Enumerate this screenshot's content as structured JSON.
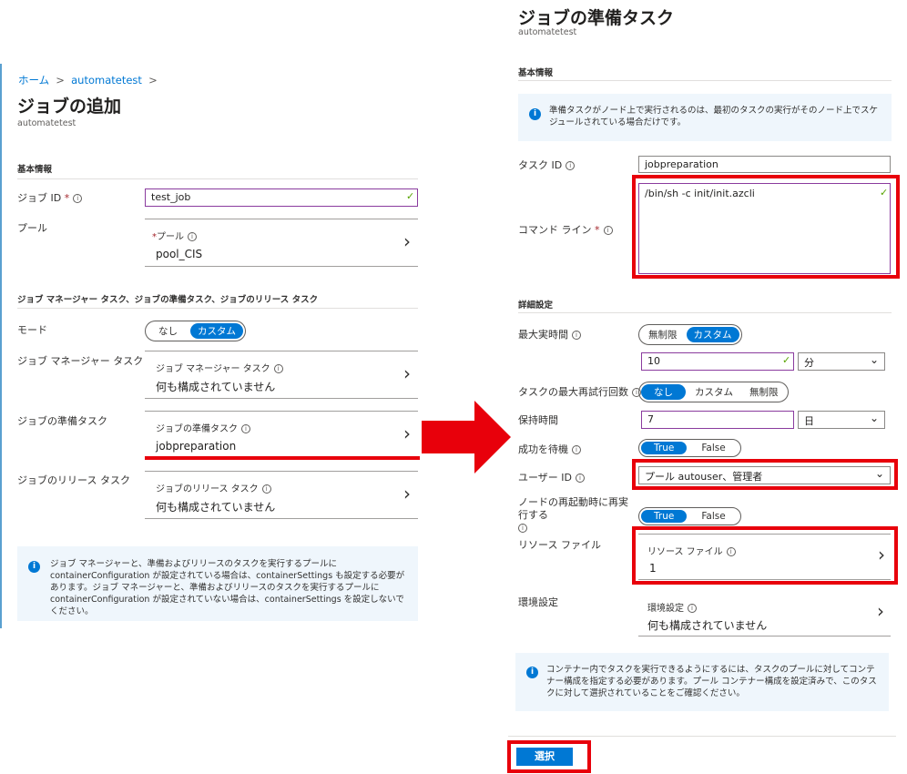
{
  "left": {
    "breadcrumb": [
      "ホーム",
      "automatetest"
    ],
    "title": "ジョブの追加",
    "subtitle": "automatetest",
    "section_basic": "基本情報",
    "job_id": {
      "label": "ジョブ ID",
      "value": "test_job"
    },
    "pool": {
      "label": "プール",
      "card_title": "プール",
      "card_value": "pool_CIS"
    },
    "section_tasks": "ジョブ マネージャー タスク、ジョブの準備タスク、ジョブのリリース タスク",
    "mode": {
      "label": "モード",
      "options": [
        "なし",
        "カスタム"
      ],
      "selected": "カスタム"
    },
    "manager_task": {
      "label": "ジョブ マネージャー タスク",
      "card_title": "ジョブ マネージャー タスク",
      "card_value": "何も構成されていません"
    },
    "prep_task": {
      "label": "ジョブの準備タスク",
      "card_title": "ジョブの準備タスク",
      "card_value": "jobpreparation"
    },
    "release_task": {
      "label": "ジョブのリリース タスク",
      "card_title": "ジョブのリリース タスク",
      "card_value": "何も構成されていません"
    },
    "info": "ジョブ マネージャーと、準備およびリリースのタスクを実行するプールに containerConfiguration が設定されている場合は、containerSettings も設定する必要があります。ジョブ マネージャーと、準備およびリリースのタスクを実行するプールに containerConfiguration が設定されていない場合は、containerSettings を設定しないでください。"
  },
  "right": {
    "title": "ジョブの準備タスク",
    "subtitle": "automatetest",
    "section_basic": "基本情報",
    "info_top": "準備タスクがノード上で実行されるのは、最初のタスクの実行がそのノード上でスケジュールされている場合だけです。",
    "task_id": {
      "label": "タスク ID",
      "value": "jobpreparation"
    },
    "command_line": {
      "label": "コマンド ライン",
      "value": "/bin/sh -c init/init.azcli"
    },
    "section_advanced": "詳細設定",
    "max_runtime": {
      "label": "最大実時間",
      "options": [
        "無制限",
        "カスタム"
      ],
      "selected": "カスタム",
      "value": "10",
      "unit": "分"
    },
    "max_retry": {
      "label": "タスクの最大再試行回数",
      "options": [
        "なし",
        "カスタム",
        "無制限"
      ],
      "selected": "なし"
    },
    "retention": {
      "label": "保持時間",
      "value": "7",
      "unit": "日"
    },
    "wait_success": {
      "label": "成功を待機",
      "options": [
        "True",
        "False"
      ],
      "selected": "True"
    },
    "user_id": {
      "label": "ユーザー ID",
      "value": "プール autouser、管理者"
    },
    "rerun_on_reboot": {
      "label": "ノードの再起動時に再実行する",
      "options": [
        "True",
        "False"
      ],
      "selected": "True"
    },
    "resource_files": {
      "label": "リソース ファイル",
      "card_title": "リソース ファイル",
      "card_value": "1"
    },
    "env_settings": {
      "label": "環境設定",
      "card_title": "環境設定",
      "card_value": "何も構成されていません"
    },
    "info_bottom": "コンテナー内でタスクを実行できるようにするには、タスクのプールに対してコンテナー構成を指定する必要があります。プール コンテナー構成を設定済みで、このタスクに対して選択されていることをご確認ください。",
    "select_button": "選択"
  },
  "colors": {
    "accent": "#0078d4",
    "highlight": "#e8000b",
    "info_bg": "#eff6fc"
  }
}
